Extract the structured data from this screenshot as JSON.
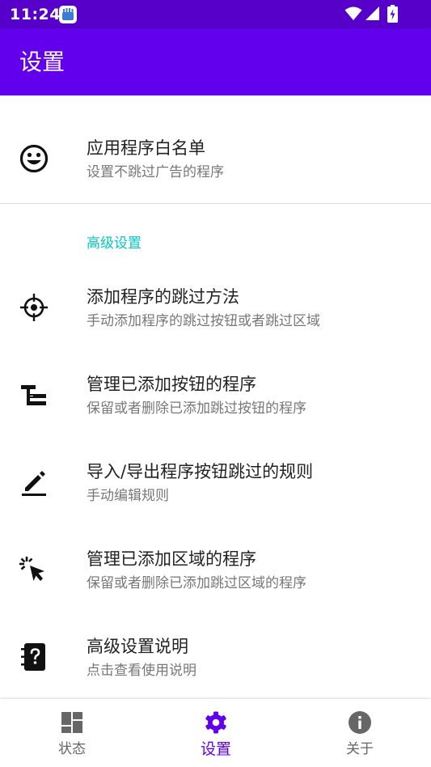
{
  "status_bar": {
    "time": "11:24"
  },
  "app_bar": {
    "title": "设置"
  },
  "colors": {
    "primary": "#6200ee",
    "status_bar": "#5700c9",
    "accent": "#03c8c4"
  },
  "whitelist": {
    "title": "应用程序白名单",
    "subtitle": "设置不跳过广告的程序",
    "icon": "smiley-icon"
  },
  "advanced": {
    "header": "高级设置",
    "items": [
      {
        "title": "添加程序的跳过方法",
        "subtitle": "手动添加程序的跳过按钮或者跳过区域",
        "icon": "crosshair-icon"
      },
      {
        "title": "管理已添加按钮的程序",
        "subtitle": "保留或者删除已添加跳过按钮的程序",
        "icon": "tree-list-icon"
      },
      {
        "title": "导入/导出程序按钮跳过的规则",
        "subtitle": "手动编辑规则",
        "icon": "pencil-icon"
      },
      {
        "title": "管理已添加区域的程序",
        "subtitle": "保留或者删除已添加跳过区域的程序",
        "icon": "cursor-click-icon"
      },
      {
        "title": "高级设置说明",
        "subtitle": "点击查看使用说明",
        "icon": "help-notebook-icon"
      }
    ]
  },
  "bottom_nav": {
    "items": [
      {
        "label": "状态",
        "icon": "dashboard-icon",
        "active": false
      },
      {
        "label": "设置",
        "icon": "gear-icon",
        "active": true
      },
      {
        "label": "关于",
        "icon": "info-icon",
        "active": false
      }
    ]
  }
}
